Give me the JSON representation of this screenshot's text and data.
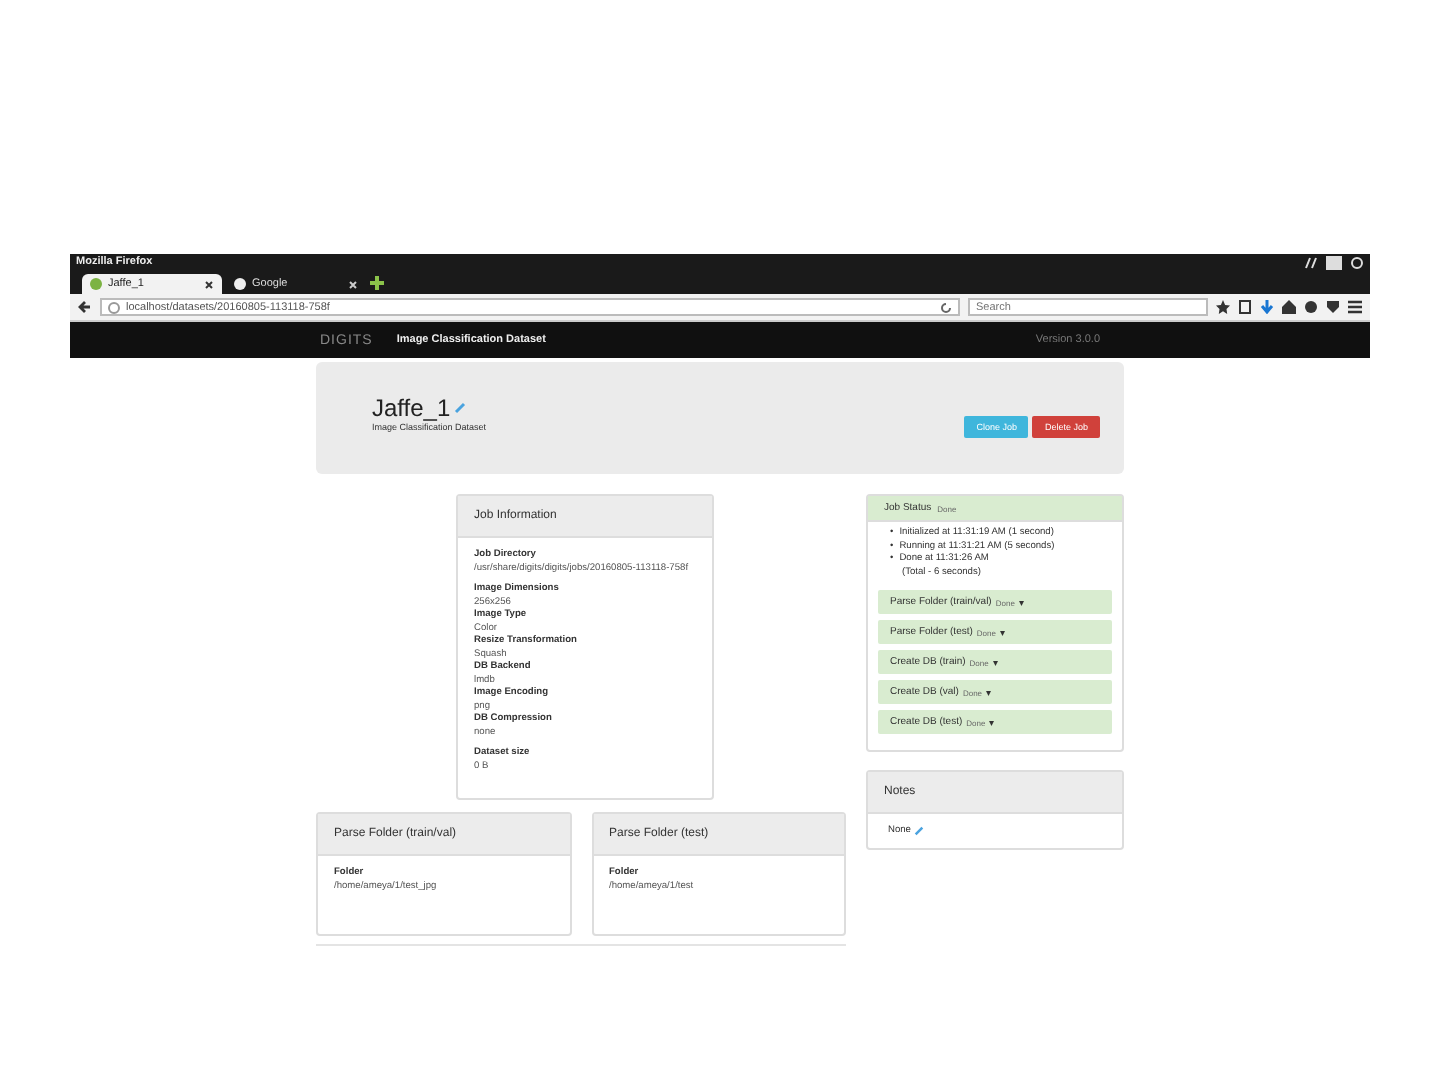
{
  "window": {
    "title": "Mozilla Firefox"
  },
  "tabs": [
    {
      "label": "Jaffe_1",
      "selected": true
    },
    {
      "label": "Google",
      "selected": false
    }
  ],
  "address_bar": {
    "url": "localhost/datasets/20160805-113118-758f"
  },
  "search": {
    "placeholder": "Search"
  },
  "navbar": {
    "brand": "DIGITS",
    "page": "Image Classification Dataset",
    "version": "Version 3.0.0"
  },
  "header": {
    "title": "Jaffe_1",
    "subtitle": "Image Classification Dataset",
    "buttons": [
      {
        "label": "Clone Job",
        "kind": "info"
      },
      {
        "label": "Delete Job",
        "kind": "danger"
      }
    ]
  },
  "job_information": {
    "title": "Job Information",
    "groups": [
      {
        "fields": [
          {
            "label": "Job Directory",
            "value": "/usr/share/digits/digits/jobs/20160805-113118-758f"
          }
        ]
      },
      {
        "fields": [
          {
            "label": "Image Dimensions",
            "value": "256x256"
          },
          {
            "label": "Image Type",
            "value": "Color"
          },
          {
            "label": "Resize Transformation",
            "value": "Squash"
          },
          {
            "label": "DB Backend",
            "value": "lmdb"
          },
          {
            "label": "Image Encoding",
            "value": "png"
          },
          {
            "label": "DB Compression",
            "value": "none"
          }
        ]
      },
      {
        "fields": [
          {
            "label": "Dataset size",
            "value": "0 B"
          }
        ]
      }
    ]
  },
  "job_status": {
    "title": "Job Status",
    "state": "Done",
    "events": [
      {
        "bullet": "•",
        "text": "Initialized at 11:31:19 AM (1 second)"
      },
      {
        "bullet": "•",
        "text": "Running at 11:31:21 AM (5 seconds)"
      },
      {
        "bullet": "•",
        "text": "Done at 11:31:26 AM"
      }
    ],
    "total": "(Total - 6 seconds)",
    "tasks": [
      {
        "name": "Parse Folder (train/val)",
        "state": "Done",
        "caret": "▾"
      },
      {
        "name": "Parse Folder (test)",
        "state": "Done",
        "caret": "▾"
      },
      {
        "name": "Create DB (train)",
        "state": "Done",
        "caret": "▾"
      },
      {
        "name": "Create DB (val)",
        "state": "Done",
        "caret": "▾"
      },
      {
        "name": "Create DB (test)",
        "state": "Done",
        "caret": "▾"
      }
    ]
  },
  "notes": {
    "title": "Notes",
    "text": "None"
  },
  "task_panels": [
    {
      "title": "Parse Folder (train/val)",
      "label": "Folder",
      "value": "/home/ameya/1/test_jpg"
    },
    {
      "title": "Parse Folder (test)",
      "label": "Folder",
      "value": "/home/ameya/1/test"
    }
  ]
}
